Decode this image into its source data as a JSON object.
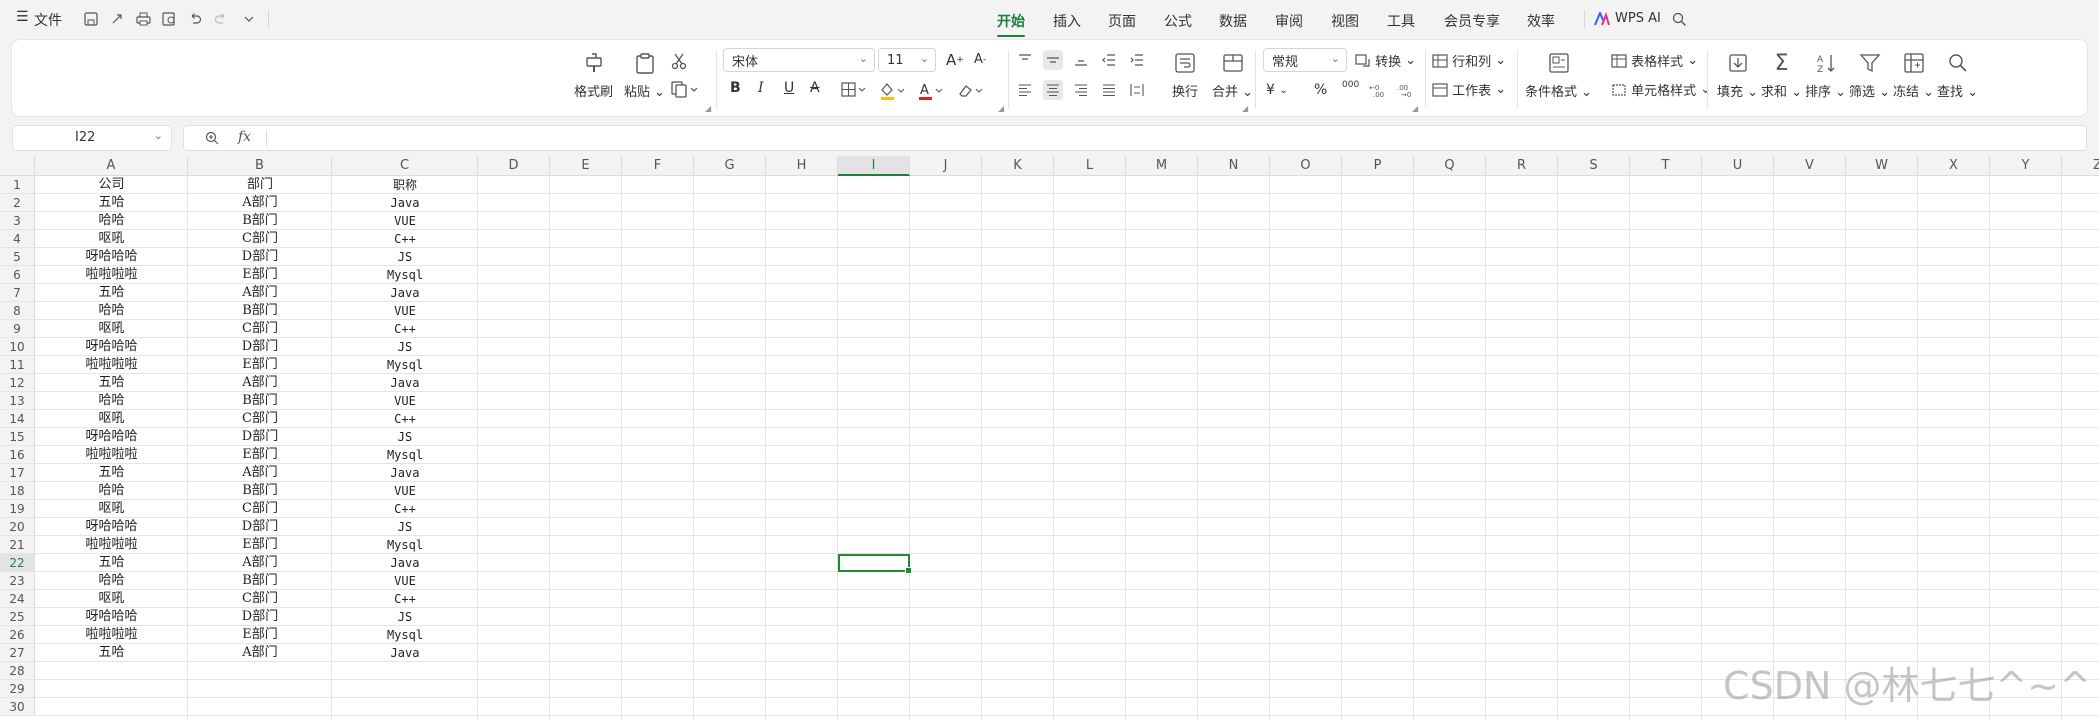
{
  "menubar": {
    "menu_icon": "☰",
    "file_label": "文件",
    "tabs": [
      "开始",
      "插入",
      "页面",
      "公式",
      "数据",
      "审阅",
      "视图",
      "工具",
      "会员专享",
      "效率"
    ],
    "active_tab": "开始",
    "wps_ai_label": "WPS AI"
  },
  "ribbon": {
    "format_painter": "格式刷",
    "paste": "粘贴",
    "font_name": "宋体",
    "font_size": "11",
    "wrap": "换行",
    "merge": "合并",
    "number_format": "常规",
    "convert": "转换",
    "row_col": "行和列",
    "worksheet": "工作表",
    "cond_format": "条件格式",
    "table_style": "表格样式",
    "cell_style": "单元格样式",
    "fill": "填充",
    "sum": "求和",
    "sort": "排序",
    "filter": "筛选",
    "freeze": "冻结",
    "find": "查找",
    "currency_symbol": "¥",
    "percent_symbol": "%",
    "thousands_symbol": "000"
  },
  "formula_bar": {
    "name_box": "I22",
    "fx": "fx",
    "formula": ""
  },
  "sheet": {
    "columns": [
      "A",
      "B",
      "C",
      "D",
      "E",
      "F",
      "G",
      "H",
      "I",
      "J",
      "K",
      "L",
      "M",
      "N",
      "O",
      "P",
      "Q",
      "R",
      "S",
      "T",
      "U",
      "V",
      "W",
      "X",
      "Y",
      "Z"
    ],
    "selected_column": "I",
    "selected_row": 22,
    "rows": [
      [
        "公司",
        "部门",
        "职称"
      ],
      [
        "五哈",
        "A部门",
        "Java"
      ],
      [
        "哈哈",
        "B部门",
        "VUE"
      ],
      [
        "呕吼",
        "C部门",
        "C++"
      ],
      [
        "呀哈哈哈",
        "D部门",
        "JS"
      ],
      [
        "啦啦啦啦",
        "E部门",
        "Mysql"
      ],
      [
        "五哈",
        "A部门",
        "Java"
      ],
      [
        "哈哈",
        "B部门",
        "VUE"
      ],
      [
        "呕吼",
        "C部门",
        "C++"
      ],
      [
        "呀哈哈哈",
        "D部门",
        "JS"
      ],
      [
        "啦啦啦啦",
        "E部门",
        "Mysql"
      ],
      [
        "五哈",
        "A部门",
        "Java"
      ],
      [
        "哈哈",
        "B部门",
        "VUE"
      ],
      [
        "呕吼",
        "C部门",
        "C++"
      ],
      [
        "呀哈哈哈",
        "D部门",
        "JS"
      ],
      [
        "啦啦啦啦",
        "E部门",
        "Mysql"
      ],
      [
        "五哈",
        "A部门",
        "Java"
      ],
      [
        "哈哈",
        "B部门",
        "VUE"
      ],
      [
        "呕吼",
        "C部门",
        "C++"
      ],
      [
        "呀哈哈哈",
        "D部门",
        "JS"
      ],
      [
        "啦啦啦啦",
        "E部门",
        "Mysql"
      ],
      [
        "五哈",
        "A部门",
        "Java"
      ],
      [
        "哈哈",
        "B部门",
        "VUE"
      ],
      [
        "呕吼",
        "C部门",
        "C++"
      ],
      [
        "呀哈哈哈",
        "D部门",
        "JS"
      ],
      [
        "啦啦啦啦",
        "E部门",
        "Mysql"
      ],
      [
        "五哈",
        "A部门",
        "Java"
      ]
    ],
    "visible_row_count": 30
  },
  "watermark": "CSDN @林七七^~^",
  "colors": {
    "accent": "#1a7f3f",
    "selection": "#1f8a2f",
    "font_red": "#e02020"
  }
}
